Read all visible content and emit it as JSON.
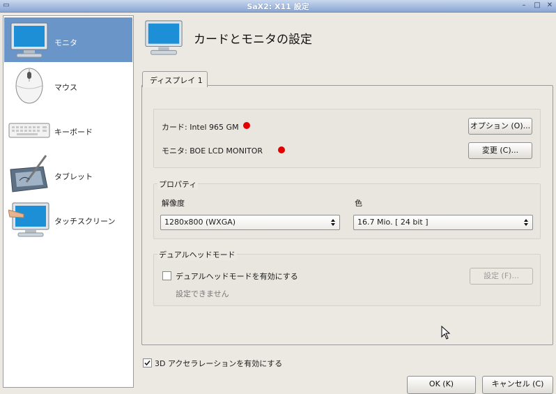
{
  "window": {
    "title": "SaX2: X11 設定"
  },
  "sidebar": {
    "items": [
      {
        "label": "モニタ",
        "icon": "monitor-icon",
        "selected": true
      },
      {
        "label": "マウス",
        "icon": "mouse-icon",
        "selected": false
      },
      {
        "label": "キーボード",
        "icon": "keyboard-icon",
        "selected": false
      },
      {
        "label": "タブレット",
        "icon": "tablet-icon",
        "selected": false
      },
      {
        "label": "タッチスクリーン",
        "icon": "touchscreen-icon",
        "selected": false
      }
    ]
  },
  "header": {
    "title": "カードとモニタの設定",
    "icon": "monitor-icon"
  },
  "tab": {
    "label": "ディスプレイ 1"
  },
  "devices": {
    "card_label": "カード: Intel 965 GM",
    "monitor_label": "モニタ: BOE LCD MONITOR",
    "options_button": "オプション (O)...",
    "change_button": "変更 (C)...",
    "status_color": "#e20000"
  },
  "properties": {
    "group_title": "プロパティ",
    "resolution_label": "解像度",
    "resolution_value": "1280x800 (WXGA)",
    "color_label": "色",
    "color_value": "16.7 Mio. [ 24 bit ]"
  },
  "dualhead": {
    "group_title": "デュアルヘッドモード",
    "enable_label": "デュアルヘッドモードを有効にする",
    "enabled": false,
    "settings_button": "設定 (F)...",
    "note": "設定できません"
  },
  "accel": {
    "label": "3D アクセラレーションを有効にする",
    "checked": true
  },
  "footer": {
    "ok_button": "OK (K)",
    "cancel_button": "キャンセル (C)"
  },
  "colors": {
    "selection": "#6a95c9",
    "titlebar": "#8aa6d3"
  }
}
